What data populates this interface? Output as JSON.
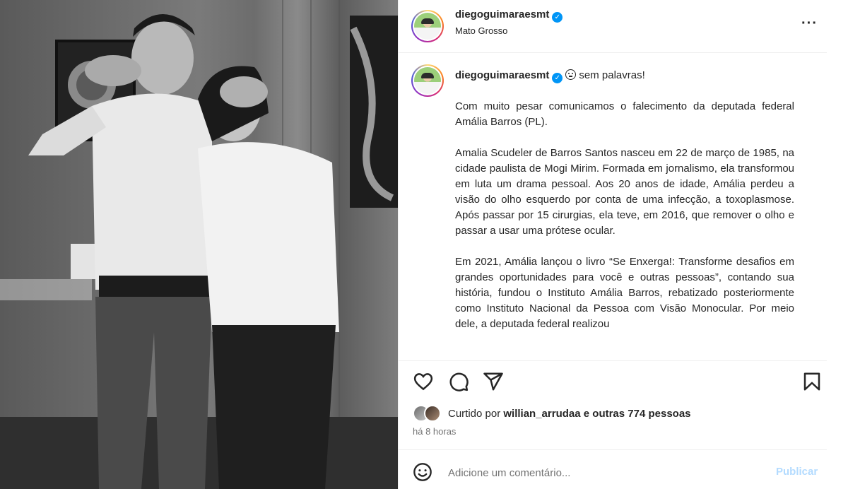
{
  "post": {
    "username": "diegoguimaraesmt",
    "location": "Mato Grosso",
    "more_icon": "more-horizontal-icon",
    "verified": true
  },
  "caption": {
    "username": "diegoguimaraesmt",
    "first_line": "sem palavras!",
    "paragraphs": [
      "Com muito pesar comunicamos o falecimento da deputada federal Amália Barros (PL).",
      "Amalia Scudeler de Barros Santos nasceu em 22 de março de 1985, na cidade paulista de Mogi Mirim. Formada em jornalismo, ela transformou em luta um drama pessoal. Aos 20 anos de idade, Amália perdeu a visão do olho esquerdo por conta de uma infecção, a toxoplasmose. Após passar por 15 cirurgias, ela teve, em 2016, que remover o olho e passar a usar uma prótese ocular.",
      "Em 2021, Amália lançou o livro “Se Enxerga!: Transforme desafios em grandes oportunidades para você e outras pessoas”, contando sua história, fundou o Instituto Amália Barros, rebatizado posteriormente como Instituto Nacional da Pessoa com Visão Monocular. Por meio dele, a deputada federal realizou"
    ]
  },
  "actions": {
    "like_icon": "heart-icon",
    "comment_icon": "comment-icon",
    "share_icon": "send-icon",
    "save_icon": "bookmark-icon"
  },
  "likes": {
    "prefix": "Curtido por",
    "user": "willian_arrudaa",
    "suffix": "e outras 774 pessoas"
  },
  "time": "há 8 horas",
  "comment": {
    "placeholder": "Adicione um comentário...",
    "publish_label": "Publicar"
  }
}
